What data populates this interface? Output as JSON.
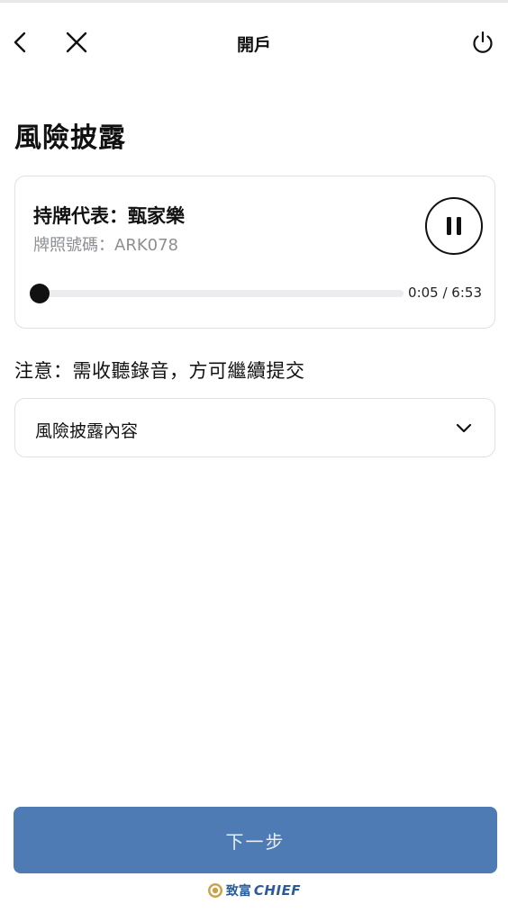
{
  "header": {
    "title": "開戶",
    "back_icon": "chevron-left-icon",
    "close_icon": "close-icon",
    "power_icon": "power-icon"
  },
  "page": {
    "title": "風險披露"
  },
  "player": {
    "representative": "持牌代表：甄家樂",
    "licence": "牌照號碼：ARK078",
    "time": "0:05 / 6:53",
    "progress": 0.0121,
    "state_icon": "pause-icon"
  },
  "notice": "注意：需收聽錄音，方可繼續提交",
  "dropdown": {
    "label": "風險披露內容",
    "icon": "chevron-down-icon"
  },
  "footer": {
    "next_label": "下一步",
    "brand_cn": "致富",
    "brand_en": "CHIEF",
    "brand_icon": "chief-logo-icon"
  },
  "colors": {
    "primary_button": "#4f7bb5",
    "brand": "#2a5c9c",
    "border": "#dfe1e4",
    "muted_text": "#8b8f94"
  }
}
